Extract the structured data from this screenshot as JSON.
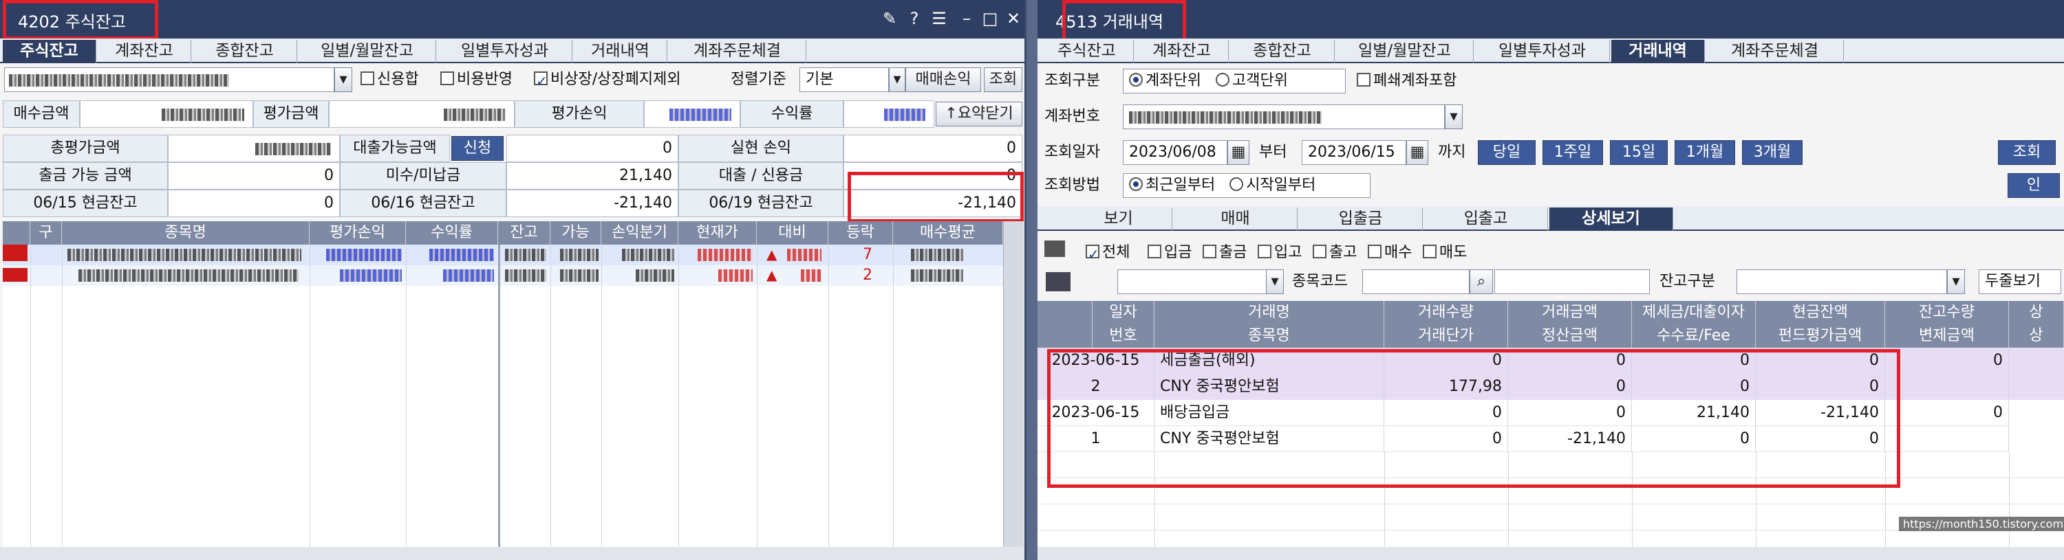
{
  "left_window": {
    "title": "4202 주식잔고",
    "tabs": [
      "주식잔고",
      "계좌잔고",
      "종합잔고",
      "일별/월말잔고",
      "일별투자성과",
      "거래내역",
      "계좌주문체결"
    ],
    "active_tab": 0,
    "options": {
      "credit_merge": "신용합",
      "cost_reflect": "비용반영",
      "exclude_delisted": "비상장/상장폐지제외",
      "sort_label": "정렬기준",
      "sort_value": "기본",
      "trade_pnl_btn": "매매손익",
      "query_btn": "조회"
    },
    "summary_labels": {
      "buy_amount": "매수금액",
      "eval_amount": "평가금액",
      "eval_pnl": "평가손익",
      "return_rate": "수익률",
      "collapse_btn": "↑요약닫기"
    },
    "summary_table": [
      [
        "총평가금액",
        "",
        "대출가능금액",
        "신청",
        "0",
        "실현 손익",
        "0"
      ],
      [
        "출금 가능 금액",
        "0",
        "미수/미납금",
        "",
        "21,140",
        "대출 / 신용금",
        "0"
      ],
      [
        "06/15 현금잔고",
        "0",
        "06/16 현금잔고",
        "",
        "-21,140",
        "06/19 현금잔고",
        "-21,140"
      ]
    ],
    "grid_headers": [
      "구",
      "종목명",
      "평가손익",
      "수익률",
      "잔고",
      "가능",
      "손익분기",
      "현재가",
      "대비",
      "등락",
      "매수평균"
    ],
    "grid_rows_visible_marks": [
      "7",
      "2"
    ]
  },
  "right_window": {
    "title": "4513 거래내역",
    "tabs": [
      "주식잔고",
      "계좌잔고",
      "종합잔고",
      "일별/월말잔고",
      "일별투자성과",
      "거래내역",
      "계좌주문체결"
    ],
    "active_tab": 5,
    "query_type_label": "조회구분",
    "query_type_options": [
      "계좌단위",
      "고객단위"
    ],
    "closed_account_label": "폐쇄계좌포함",
    "account_label": "계좌번호",
    "date_label": "조회일자",
    "date_from": "2023/06/08",
    "date_sep": "부터",
    "date_to": "2023/06/15",
    "date_until": "까지",
    "period_buttons": [
      "당일",
      "1주일",
      "15일",
      "1개월",
      "3개월"
    ],
    "query_btn": "조회",
    "extra_btn": "인",
    "method_label": "조회방법",
    "method_options": [
      "최근일부터",
      "시작일부터"
    ],
    "sub_tabs": [
      "보기",
      "매매",
      "입출금",
      "입출고",
      "상세보기"
    ],
    "active_sub_tab": 4,
    "filter_checks": [
      "전체",
      "입금",
      "출금",
      "입고",
      "출고",
      "매수",
      "매도"
    ],
    "stock_code_label": "종목코드",
    "balance_type_label": "잔고구분",
    "view_select": "두줄보기",
    "grid_headers_row1": [
      "일자",
      "거래명",
      "거래수량",
      "거래금액",
      "제세금/대출이자",
      "현금잔액",
      "잔고수량",
      "상"
    ],
    "grid_headers_row2": [
      "번호",
      "종목명",
      "거래단가",
      "정산금액",
      "수수료/Fee",
      "펀드평가금액",
      "변제금액",
      "상"
    ],
    "rows": [
      {
        "c1": "2023-06-15",
        "c2": "세금출금(해외)",
        "c3": "0",
        "c4": "0",
        "c5": "0",
        "c6": "0",
        "c7": "0"
      },
      {
        "c1": "2",
        "c2": "CNY 중국평안보험",
        "c3": "177,98",
        "c4": "0",
        "c5": "0",
        "c6": "0",
        "c7": ""
      },
      {
        "c1": "2023-06-15",
        "c2": "배당금입금",
        "c3": "0",
        "c4": "0",
        "c5": "21,140",
        "c6": "-21,140",
        "c7": "0"
      },
      {
        "c1": "1",
        "c2": "CNY 중국평안보험",
        "c3": "0",
        "c4": "-21,140",
        "c5": "0",
        "c6": "0",
        "c7": ""
      }
    ],
    "watermark": "https://month150.tistory.com"
  },
  "colors": {
    "titlebar": "#2e3f63",
    "highlight": "#e0202a",
    "row_purple": "#e8dcf5",
    "row_blue": "#dfe8fb"
  }
}
